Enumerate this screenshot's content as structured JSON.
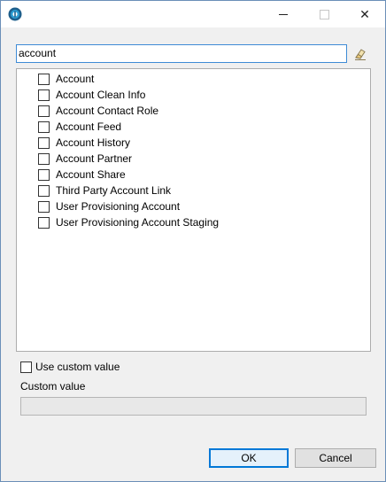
{
  "window": {
    "app_icon": "talend-icon",
    "minimize_icon": "minimize-icon",
    "maximize_icon": "maximize-icon",
    "close_icon": "close-icon",
    "close_glyph": "✕"
  },
  "filter": {
    "value": "account",
    "clear_icon": "eraser-icon"
  },
  "list": {
    "items": [
      {
        "label": "Account",
        "checked": false
      },
      {
        "label": "Account Clean Info",
        "checked": false
      },
      {
        "label": "Account Contact Role",
        "checked": false
      },
      {
        "label": "Account Feed",
        "checked": false
      },
      {
        "label": "Account History",
        "checked": false
      },
      {
        "label": "Account Partner",
        "checked": false
      },
      {
        "label": "Account Share",
        "checked": false
      },
      {
        "label": "Third Party Account Link",
        "checked": false
      },
      {
        "label": "User Provisioning Account",
        "checked": false
      },
      {
        "label": "User Provisioning Account Staging",
        "checked": false
      }
    ]
  },
  "custom": {
    "use_custom_label": "Use custom value",
    "use_custom_checked": false,
    "value_label": "Custom value",
    "value": ""
  },
  "buttons": {
    "ok": "OK",
    "cancel": "Cancel"
  },
  "colors": {
    "accent": "#0078d7",
    "focus_border": "#3e8bd6",
    "window_border": "#6b8fb8"
  }
}
